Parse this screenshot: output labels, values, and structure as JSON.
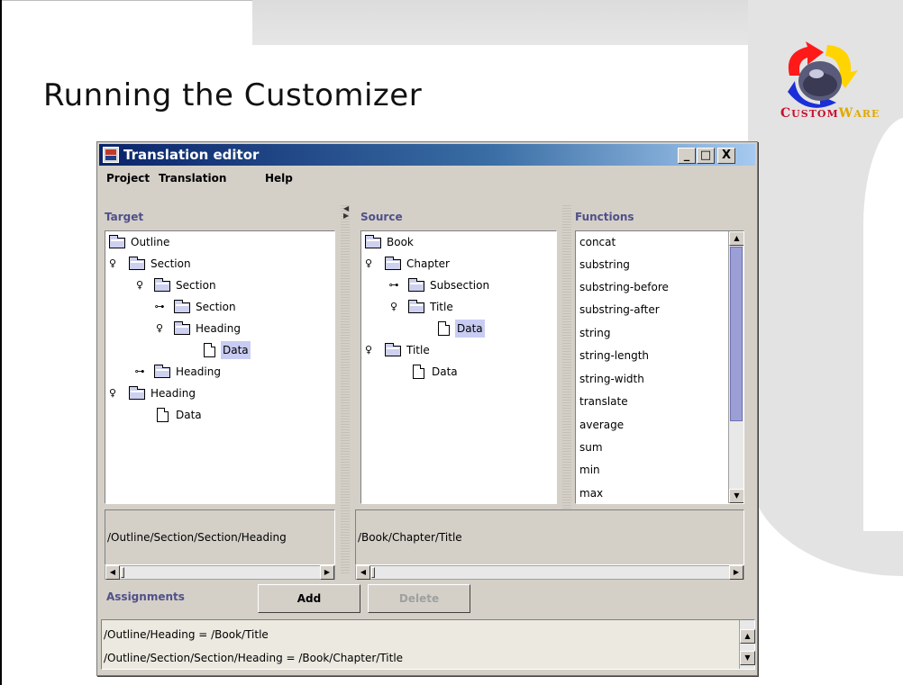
{
  "slide": {
    "title": "Running the Customizer",
    "logo_text": "CUSTOMWARE"
  },
  "window": {
    "title": "Translation editor",
    "controls": {
      "minimize": "_",
      "maximize": "□",
      "close": "X"
    }
  },
  "menu": [
    "Project",
    "Translation",
    "Help"
  ],
  "target": {
    "header": "Target",
    "nodes": [
      {
        "label": "Outline",
        "kind": "folder",
        "toggle": ""
      },
      {
        "label": "Section",
        "kind": "folder",
        "toggle": "expanded"
      },
      {
        "label": "Section",
        "kind": "folder",
        "toggle": "expanded"
      },
      {
        "label": "Section",
        "kind": "folder",
        "toggle": "collapsed"
      },
      {
        "label": "Heading",
        "kind": "folder",
        "toggle": "expanded"
      },
      {
        "label": "Data",
        "kind": "doc",
        "toggle": "",
        "selected": true
      },
      {
        "label": "Heading",
        "kind": "folder",
        "toggle": "collapsed"
      },
      {
        "label": "Heading",
        "kind": "folder",
        "toggle": "expanded"
      },
      {
        "label": "Data",
        "kind": "doc",
        "toggle": ""
      }
    ],
    "path": "/Outline/Section/Section/Heading"
  },
  "source": {
    "header": "Source",
    "nodes": [
      {
        "label": "Book",
        "kind": "folder",
        "toggle": ""
      },
      {
        "label": "Chapter",
        "kind": "folder",
        "toggle": "expanded"
      },
      {
        "label": "Subsection",
        "kind": "folder",
        "toggle": "collapsed"
      },
      {
        "label": "Title",
        "kind": "folder",
        "toggle": "expanded"
      },
      {
        "label": "Data",
        "kind": "doc",
        "toggle": "",
        "selected": true
      },
      {
        "label": "Title",
        "kind": "folder",
        "toggle": "expanded"
      },
      {
        "label": "Data",
        "kind": "doc",
        "toggle": ""
      }
    ],
    "path": "/Book/Chapter/Title"
  },
  "functions": {
    "header": "Functions",
    "items": [
      "concat",
      "substring",
      "substring-before",
      "substring-after",
      "string",
      "string-length",
      "string-width",
      "translate",
      "average",
      "sum",
      "min",
      "max"
    ]
  },
  "assignments": {
    "label": "Assignments",
    "add_label": "Add",
    "delete_label": "Delete",
    "items": [
      "/Outline/Heading = /Book/Title",
      "/Outline/Section/Section/Heading = /Book/Chapter/Title"
    ]
  },
  "icons": {
    "expanded": "node-expanded-icon",
    "collapsed": "node-collapsed-icon",
    "folder": "folder-icon",
    "doc": "document-icon"
  },
  "colors": {
    "titlebar": "#0a246a",
    "selection": "#c9ccf2",
    "header_text": "#50508a",
    "scroll_thumb": "#9b9fd6"
  }
}
